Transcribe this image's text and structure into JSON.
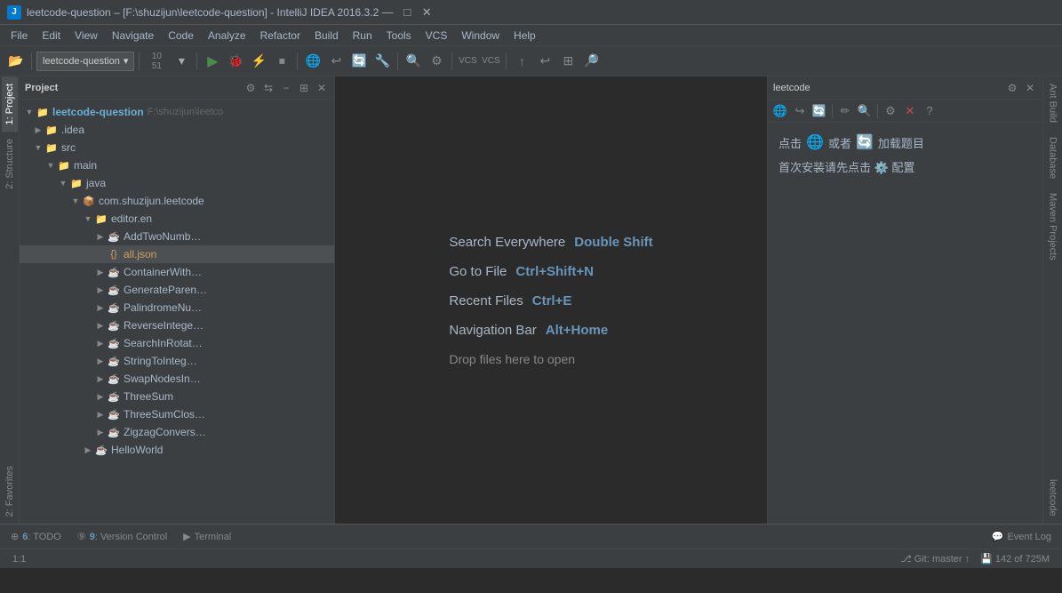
{
  "title_bar": {
    "icon": "J",
    "text": "leetcode-question – [F:\\shuzijun\\leetcode-question] - IntelliJ IDEA 2016.3.2",
    "minimize": "—",
    "maximize": "□",
    "close": "✕"
  },
  "menu": {
    "items": [
      "File",
      "Edit",
      "View",
      "Navigate",
      "Code",
      "Analyze",
      "Refactor",
      "Build",
      "Run",
      "Tools",
      "VCS",
      "Window",
      "Help"
    ]
  },
  "toolbar": {
    "project_label": "leetcode-question",
    "dropdown_arrow": "▾"
  },
  "project_panel": {
    "title": "Project",
    "root": "leetcode-question",
    "root_path": "F:\\shuzijun\\leetco",
    "items": [
      {
        "indent": 1,
        "arrow": "▶",
        "icon": "📁",
        "label": ".idea",
        "type": "folder"
      },
      {
        "indent": 1,
        "arrow": "▼",
        "icon": "📁",
        "label": "src",
        "type": "folder"
      },
      {
        "indent": 2,
        "arrow": "▼",
        "icon": "📁",
        "label": "main",
        "type": "folder"
      },
      {
        "indent": 3,
        "arrow": "▼",
        "icon": "📁",
        "label": "java",
        "type": "folder"
      },
      {
        "indent": 4,
        "arrow": "▼",
        "icon": "📦",
        "label": "com.shuzijun.leetcode",
        "type": "package"
      },
      {
        "indent": 5,
        "arrow": "▼",
        "icon": "📁",
        "label": "editor.en",
        "type": "folder"
      },
      {
        "indent": 6,
        "arrow": "▶",
        "icon": "☕",
        "label": "AddTwoNumb…",
        "type": "java"
      },
      {
        "indent": 6,
        "arrow": "",
        "icon": "{}",
        "label": "all.json",
        "type": "json"
      },
      {
        "indent": 6,
        "arrow": "▶",
        "icon": "📁",
        "label": "ContainerWith…",
        "type": "folder"
      },
      {
        "indent": 6,
        "arrow": "▶",
        "icon": "📁",
        "label": "GenerateParen…",
        "type": "folder"
      },
      {
        "indent": 6,
        "arrow": "▶",
        "icon": "📁",
        "label": "PalindromeNu…",
        "type": "folder"
      },
      {
        "indent": 6,
        "arrow": "▶",
        "icon": "📁",
        "label": "ReverseIntege…",
        "type": "folder"
      },
      {
        "indent": 6,
        "arrow": "▶",
        "icon": "📁",
        "label": "SearchInRotat…",
        "type": "folder"
      },
      {
        "indent": 6,
        "arrow": "▶",
        "icon": "📁",
        "label": "StringToInteg…",
        "type": "folder"
      },
      {
        "indent": 6,
        "arrow": "▶",
        "icon": "📁",
        "label": "SwapNodesIn…",
        "type": "folder"
      },
      {
        "indent": 6,
        "arrow": "▶",
        "icon": "📁",
        "label": "ThreeSum",
        "type": "folder"
      },
      {
        "indent": 6,
        "arrow": "▶",
        "icon": "📁",
        "label": "ThreeSumClos…",
        "type": "folder"
      },
      {
        "indent": 6,
        "arrow": "▶",
        "icon": "📁",
        "label": "ZigzagConvers…",
        "type": "folder"
      },
      {
        "indent": 5,
        "arrow": "▶",
        "icon": "📁",
        "label": "HelloWorld",
        "type": "folder"
      }
    ]
  },
  "editor": {
    "welcome": {
      "search_everywhere_label": "Search Everywhere",
      "search_everywhere_shortcut": "Double Shift",
      "go_to_file_label": "Go to File",
      "go_to_file_shortcut": "Ctrl+Shift+N",
      "recent_files_label": "Recent Files",
      "recent_files_shortcut": "Ctrl+E",
      "navigation_bar_label": "Navigation Bar",
      "navigation_bar_shortcut": "Alt+Home",
      "drop_files_label": "Drop files here to open"
    }
  },
  "leetcode_panel": {
    "title": "leetcode",
    "line1_prefix": "点击",
    "line1_globe": "🌐",
    "line1_middle": "或者",
    "line1_refresh": "🔄",
    "line1_suffix": "加载题目",
    "line2": "首次安装请先点击 ⚙️ 配置"
  },
  "right_sidebar": {
    "tabs": [
      "Ant Build",
      "Database",
      "m\nMaven Projects"
    ]
  },
  "far_right": {
    "tab": "leetcode"
  },
  "left_sidebar": {
    "tabs": [
      "1: Project",
      "2: Structure",
      "2: Favorites"
    ]
  },
  "status_bar": {
    "todo": "6: TODO",
    "vcs": "9: Version Control",
    "terminal": "Terminal",
    "event_log": "Event Log",
    "position": "1:1",
    "git": "Git: master ↑",
    "encoding": "142 of 725M"
  }
}
